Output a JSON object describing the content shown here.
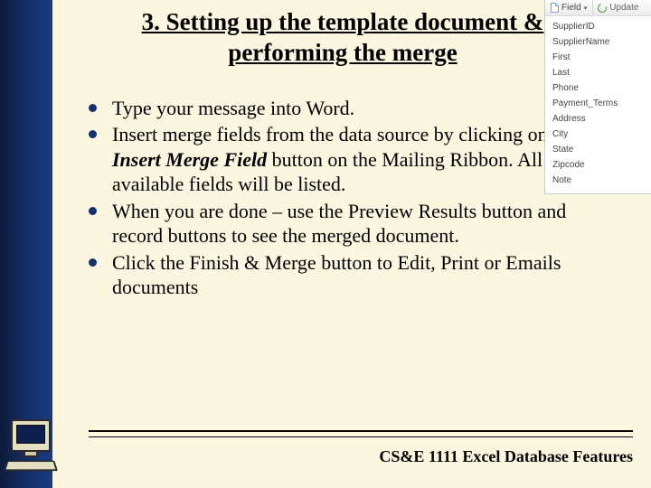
{
  "title_line1": "3. Setting up the template document &",
  "title_line2": "performing the merge",
  "bullets": [
    "Type your message into Word.",
    "Insert merge fields from the data source by clicking on the ",
    "When you are done – use the Preview Results button and record buttons to see the merged document.",
    "Click the Finish & Merge button to Edit, Print or Emails documents"
  ],
  "bullet2_emph": "Insert Merge Field",
  "bullet2_tail": " button on the Mailing Ribbon. All available fields will be listed.",
  "footer": "CS&E 1111 Excel Database Features",
  "panel": {
    "field_label": "Field",
    "update_label": "Update",
    "items": [
      "SupplierID",
      "SupplierName",
      "First",
      "Last",
      "Phone",
      "Payment_Terms",
      "Address",
      "City",
      "State",
      "Zipcode",
      "Note"
    ]
  }
}
